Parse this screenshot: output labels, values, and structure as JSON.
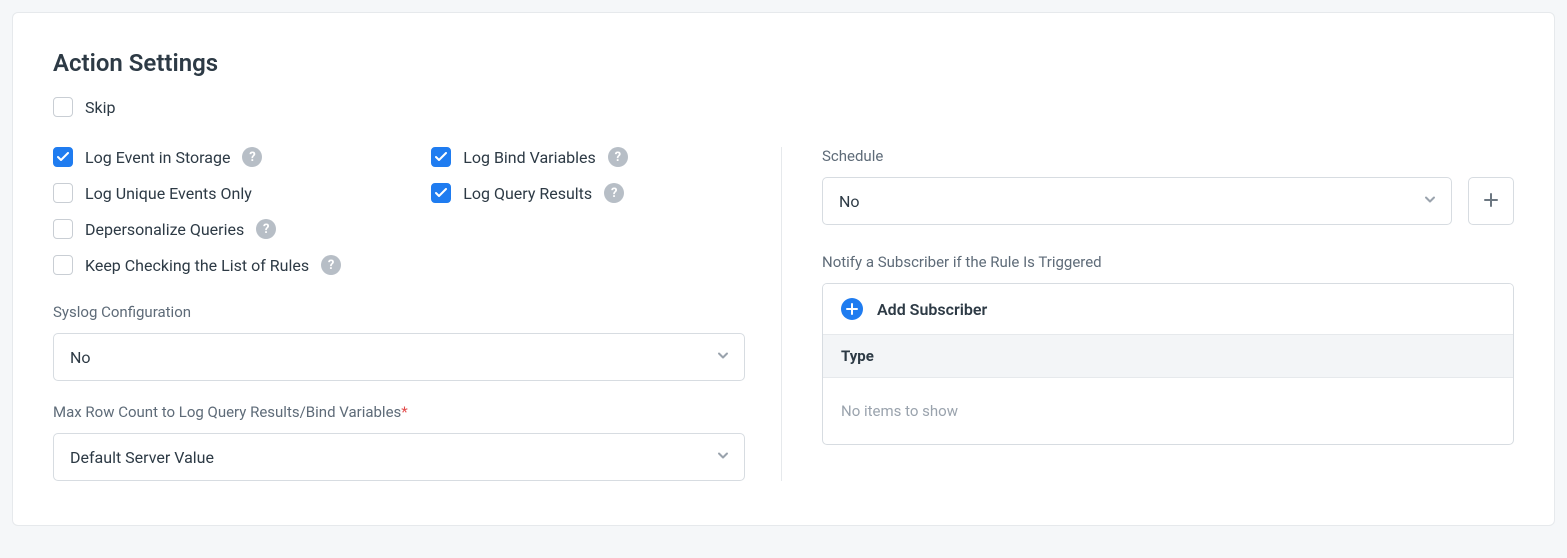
{
  "title": "Action Settings",
  "checks": {
    "skip": "Skip",
    "log_event": "Log Event in Storage",
    "log_unique": "Log Unique Events Only",
    "depersonalize": "Depersonalize Queries",
    "keep_checking": "Keep Checking the List of Rules",
    "log_bind": "Log Bind Variables",
    "log_query": "Log Query Results"
  },
  "labels": {
    "syslog": "Syslog Configuration",
    "max_rows": "Max Row Count to Log Query Results/Bind Variables",
    "schedule": "Schedule",
    "notify": "Notify a Subscriber if the Rule Is Triggered",
    "add_subscriber": "Add Subscriber",
    "type_header": "Type",
    "no_items": "No items to show"
  },
  "values": {
    "syslog": "No",
    "max_rows": "Default Server Value",
    "schedule": "No"
  }
}
